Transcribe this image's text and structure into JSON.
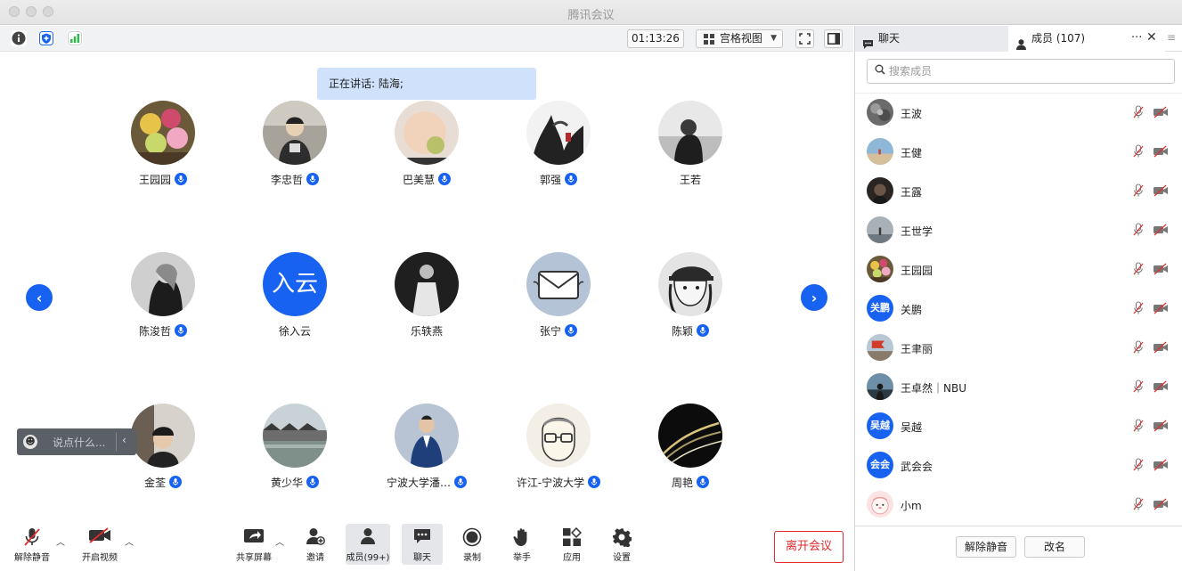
{
  "window": {
    "title": "腾讯会议"
  },
  "top_toolbar": {
    "timer": "01:13:26",
    "view_label": "宫格视图"
  },
  "speaking": "正在讲话: 陆海;",
  "colors": {
    "accent": "#1862f2",
    "leave": "#e02b2b",
    "speaking_bg": "#cfe1fb"
  },
  "participants": [
    {
      "name": "王园园",
      "mic": true,
      "avatar": "flowers"
    },
    {
      "name": "李忠哲",
      "mic": true,
      "avatar": "person-street"
    },
    {
      "name": "巴美慧",
      "mic": true,
      "avatar": "baby"
    },
    {
      "name": "郭强",
      "mic": true,
      "avatar": "ink-painting"
    },
    {
      "name": "王若",
      "mic": false,
      "avatar": "bw-person"
    },
    {
      "name": "陈浚哲",
      "mic": true,
      "avatar": "bw-woman"
    },
    {
      "name": "徐入云",
      "mic": false,
      "avatar_text": "入云"
    },
    {
      "name": "乐轶燕",
      "mic": false,
      "avatar": "bw-dress"
    },
    {
      "name": "张宁",
      "mic": true,
      "avatar": "envelope"
    },
    {
      "name": "陈颖",
      "mic": true,
      "avatar": "cartoon-cap"
    },
    {
      "name": "金荃",
      "mic": true,
      "avatar": "selfie"
    },
    {
      "name": "黄少华",
      "mic": true,
      "avatar": "waterside"
    },
    {
      "name": "宁波大学潘…",
      "mic": true,
      "avatar": "suit"
    },
    {
      "name": "许江-宁波大学",
      "mic": true,
      "avatar": "sketch-glasses"
    },
    {
      "name": "周艳",
      "mic": true,
      "avatar": "dark-lines"
    }
  ],
  "chat_input": {
    "placeholder": "说点什么..."
  },
  "bottom_toolbar": {
    "unmute": "解除静音",
    "start_video": "开启视频",
    "share_screen": "共享屏幕",
    "invite": "邀请",
    "members": "成员(99+)",
    "chat": "聊天",
    "record": "录制",
    "raise_hand": "举手",
    "apps": "应用",
    "settings": "设置",
    "leave": "离开会议"
  },
  "panel": {
    "tab_chat": "聊天",
    "tab_members": "成员 (107)",
    "search_placeholder": "搜索成员",
    "members": [
      {
        "name": "王波",
        "avatar": "gray-texture"
      },
      {
        "name": "王健",
        "avatar": "beach"
      },
      {
        "name": "王露",
        "avatar": "dark-portrait"
      },
      {
        "name": "王世学",
        "avatar": "gray-sky"
      },
      {
        "name": "王园园",
        "avatar": "flowers"
      },
      {
        "name": "关鹏",
        "avatar_text": "关鹏"
      },
      {
        "name": "王聿丽",
        "avatar": "red-flag"
      },
      {
        "name": "王卓然｜NBU",
        "avatar": "silhouette"
      },
      {
        "name": "吴越",
        "avatar_text": "吴越"
      },
      {
        "name": "武会会",
        "avatar_text": "会会"
      },
      {
        "name": "小m",
        "avatar": "pink-cartoon"
      }
    ],
    "unmute_all": "解除静音",
    "rename": "改名"
  }
}
